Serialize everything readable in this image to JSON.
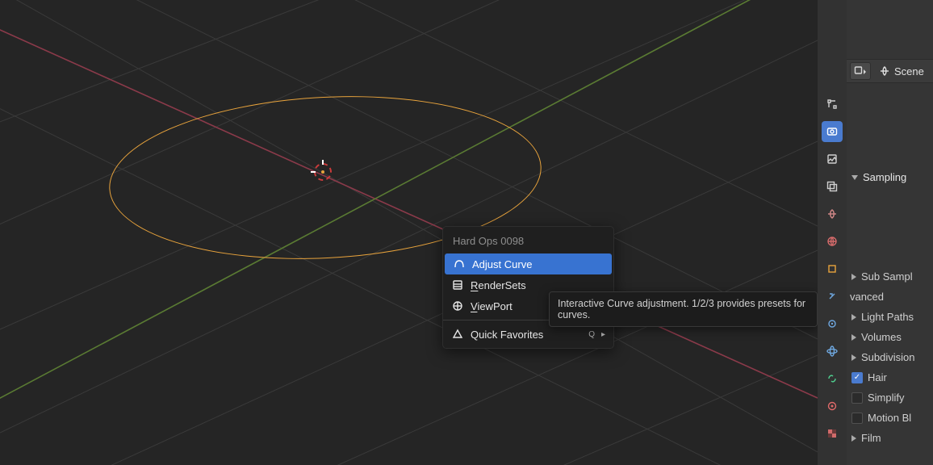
{
  "context_menu": {
    "title": "Hard Ops 0098",
    "items": [
      {
        "label": "Adjust Curve",
        "icon": "curve-icon",
        "highlight": true,
        "submenu": false
      },
      {
        "label": "RenderSets",
        "icon": "rendersets-icon",
        "underline_first": "R",
        "submenu": false
      },
      {
        "label": "ViewPort",
        "icon": "viewport-icon",
        "underline_first": "V",
        "submenu": false
      },
      {
        "label": "Quick Favorites",
        "icon": "favorites-icon",
        "shortcut": "Q",
        "submenu": true
      }
    ],
    "separator_before_index": 3
  },
  "tooltip": {
    "text": "Interactive Curve adjustment. 1/2/3 provides presets for curves."
  },
  "header": {
    "scene_label": "Scene"
  },
  "properties_panel": {
    "sampling_label": "Sampling",
    "rows": [
      {
        "tri": true,
        "label": "Sub Sampl"
      },
      {
        "plain_sub": true,
        "label": "vanced "
      },
      {
        "tri": true,
        "label": "Light Paths"
      },
      {
        "tri": true,
        "label": "Volumes"
      },
      {
        "tri": true,
        "label": "Subdivision"
      },
      {
        "check": true,
        "checked": true,
        "label": "Hair"
      },
      {
        "check": true,
        "checked": false,
        "label": "Simplify"
      },
      {
        "check": true,
        "checked": false,
        "label": "Motion Bl"
      },
      {
        "tri": true,
        "label": "Film"
      }
    ]
  },
  "icon_column": {
    "buttons": [
      {
        "name": "tools-icon"
      },
      {
        "name": "render-icon",
        "active": true
      },
      {
        "name": "output-icon"
      },
      {
        "name": "viewlayer-icon"
      },
      {
        "name": "scene-icon"
      },
      {
        "name": "world-icon"
      },
      {
        "name": "object-icon"
      },
      {
        "name": "modifier-icon"
      },
      {
        "name": "particle-icon"
      },
      {
        "name": "physics-icon"
      },
      {
        "name": "constraint-icon"
      },
      {
        "name": "data-icon"
      },
      {
        "name": "texture-icon"
      }
    ]
  }
}
